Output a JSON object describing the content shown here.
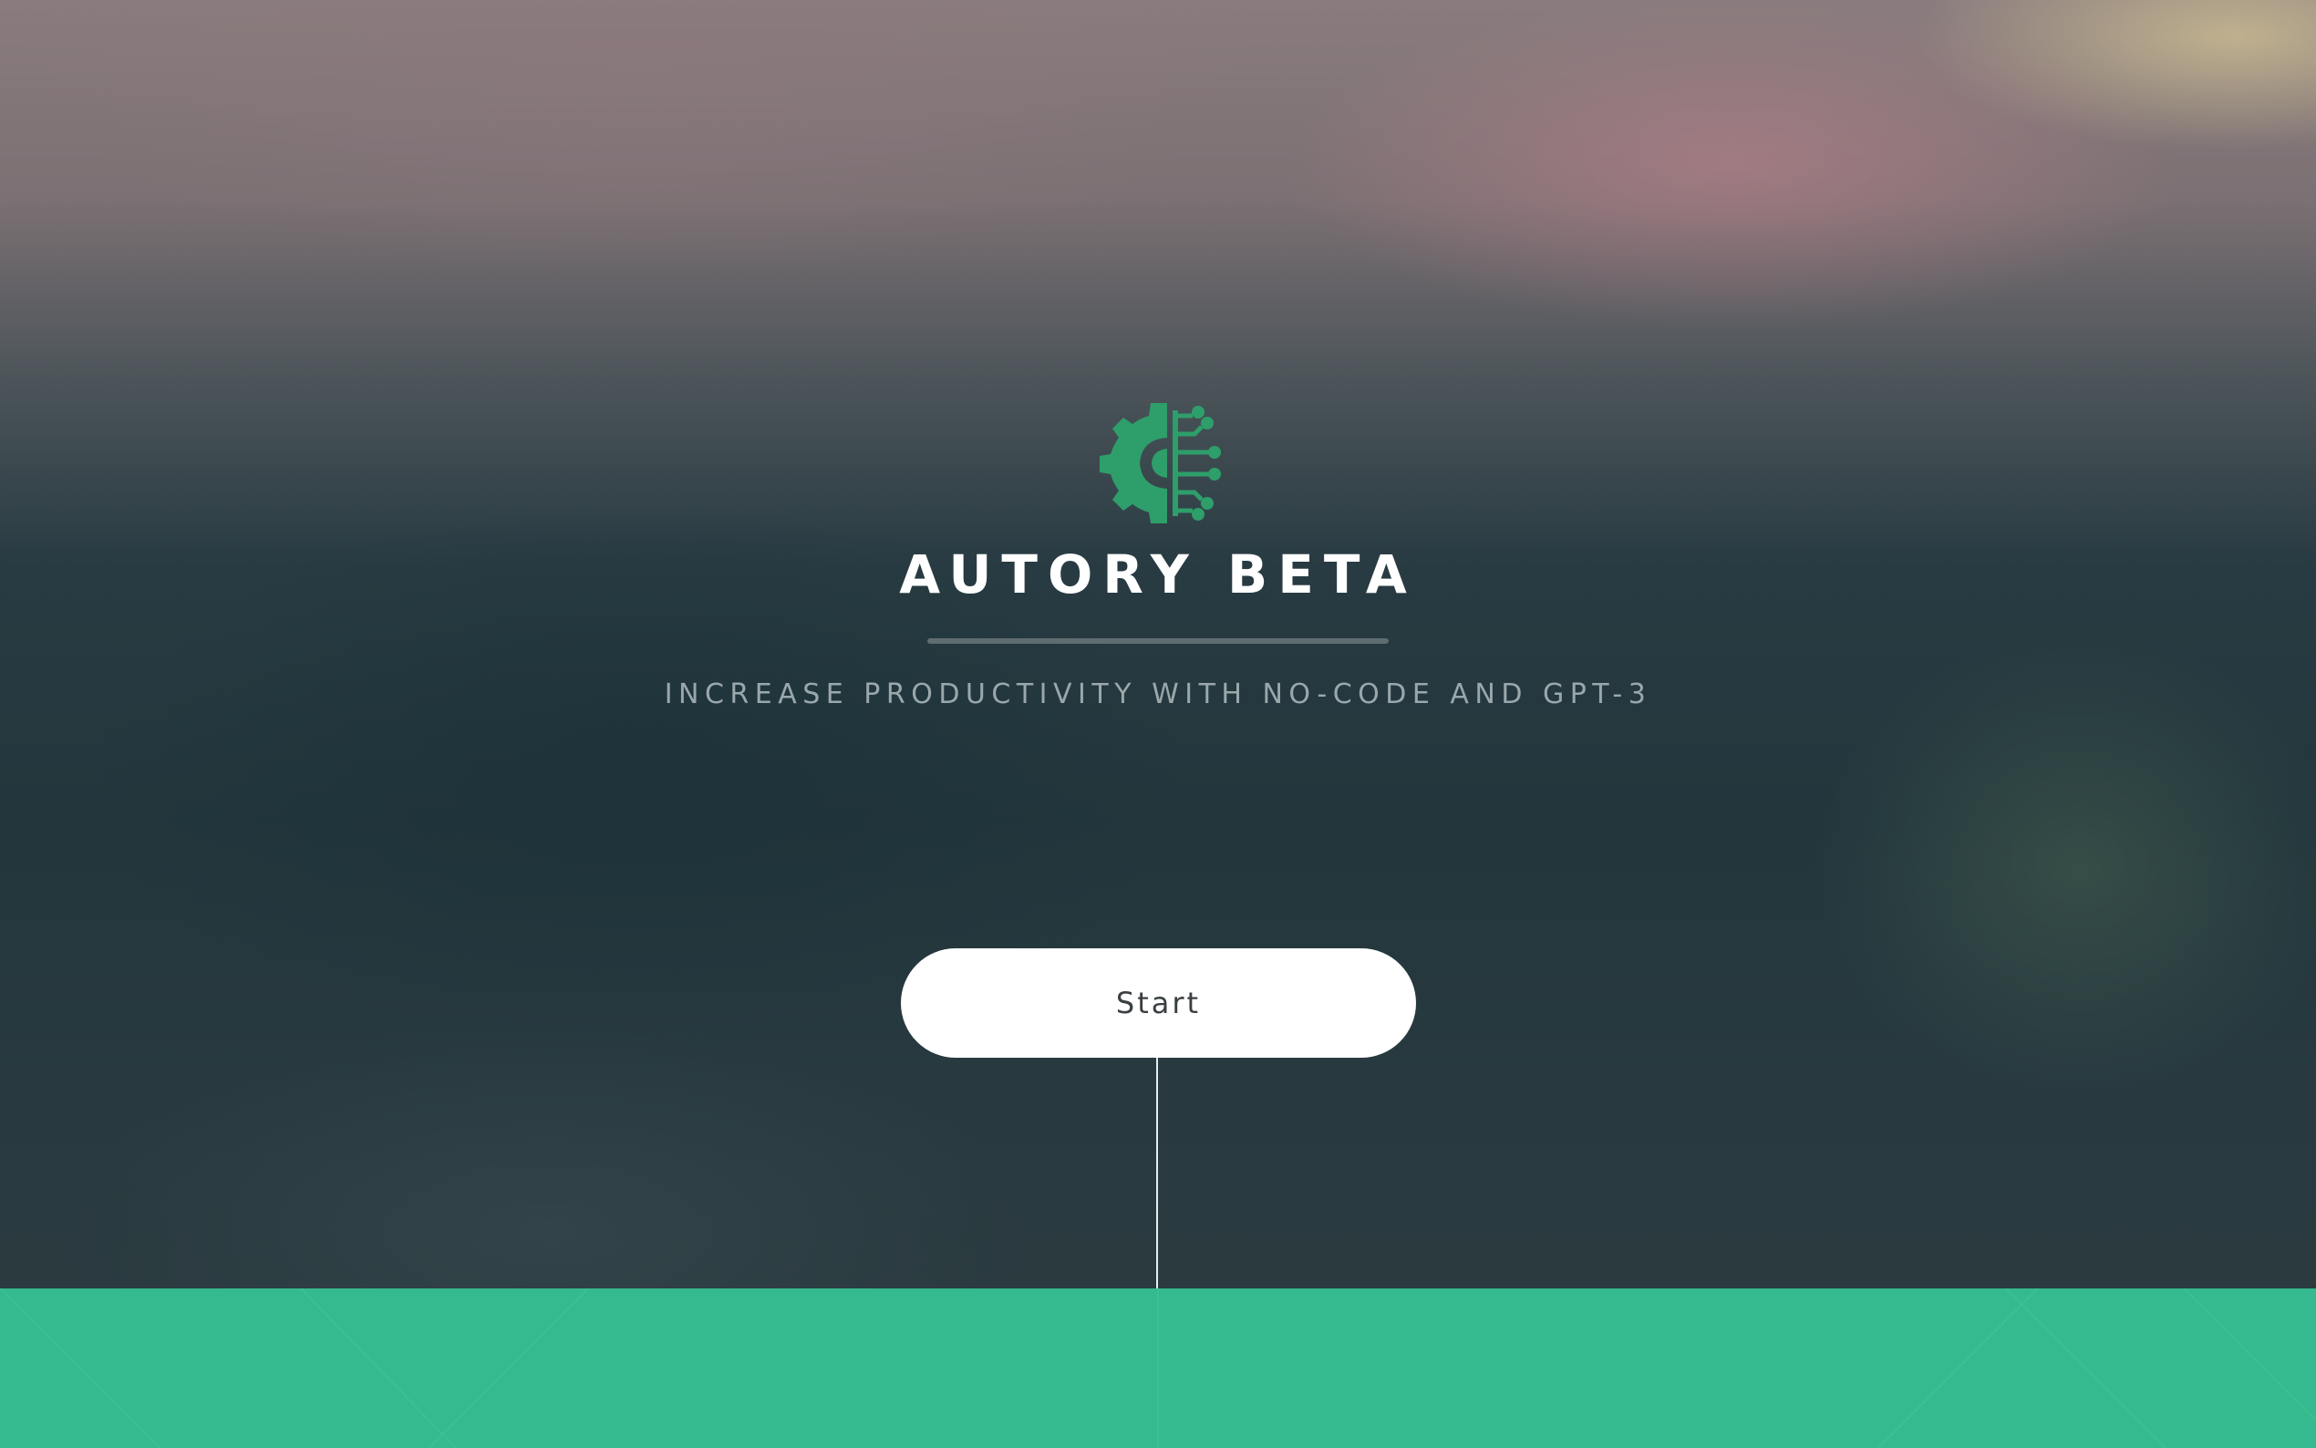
{
  "hero": {
    "logo_icon": "gear-circuit-icon",
    "title": "AUTORY BETA",
    "subtitle": "INCREASE PRODUCTIVITY WITH NO-CODE AND GPT-3",
    "start_label": "Start"
  },
  "colors": {
    "brand_green": "#35b98e",
    "logo_green": "#2e9e6a",
    "button_bg": "#ffffff",
    "title_text": "#ffffff",
    "subtitle_text": "#9aa8ab"
  }
}
